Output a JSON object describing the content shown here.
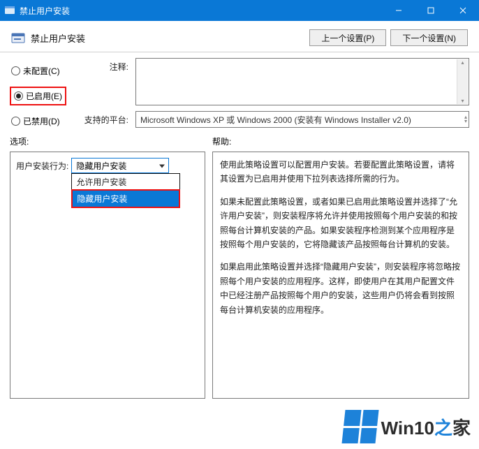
{
  "titlebar": {
    "title": "禁止用户安装"
  },
  "header": {
    "title": "禁止用户安装",
    "prev_btn": "上一个设置(P)",
    "next_btn": "下一个设置(N)"
  },
  "radios": {
    "not_configured": "未配置(C)",
    "enabled": "已启用(E)",
    "disabled": "已禁用(D)",
    "selected": "enabled"
  },
  "fields": {
    "comment_label": "注释:",
    "comment_value": "",
    "supported_label": "支持的平台:",
    "supported_value": "Microsoft Windows XP 或 Windows 2000 (安装有 Windows Installer v2.0)"
  },
  "sections": {
    "options_label": "选项:",
    "help_label": "帮助:"
  },
  "options": {
    "behavior_label": "用户安装行为:",
    "combo_selected": "隐藏用户安装",
    "dropdown": {
      "item_allow": "允许用户安装",
      "item_hide": "隐藏用户安装"
    }
  },
  "help": {
    "p1": "使用此策略设置可以配置用户安装。若要配置此策略设置，请将其设置为已启用并使用下拉列表选择所需的行为。",
    "p2": "如果未配置此策略设置，或者如果已启用此策略设置并选择了“允许用户安装”，则安装程序将允许并使用按照每个用户安装的和按照每台计算机安装的产品。如果安装程序检测到某个应用程序是按照每个用户安装的，它将隐藏该产品按照每台计算机的安装。",
    "p3": "如果启用此策略设置并选择“隐藏用户安装”，则安装程序将忽略按照每个用户安装的应用程序。这样，即使用户在其用户配置文件中已经注册产品按照每个用户的安装，这些用户仍将会看到按照每台计算机安装的应用程序。"
  },
  "watermark": {
    "text_a": "Win10",
    "text_b": "之",
    "text_c": "家"
  }
}
